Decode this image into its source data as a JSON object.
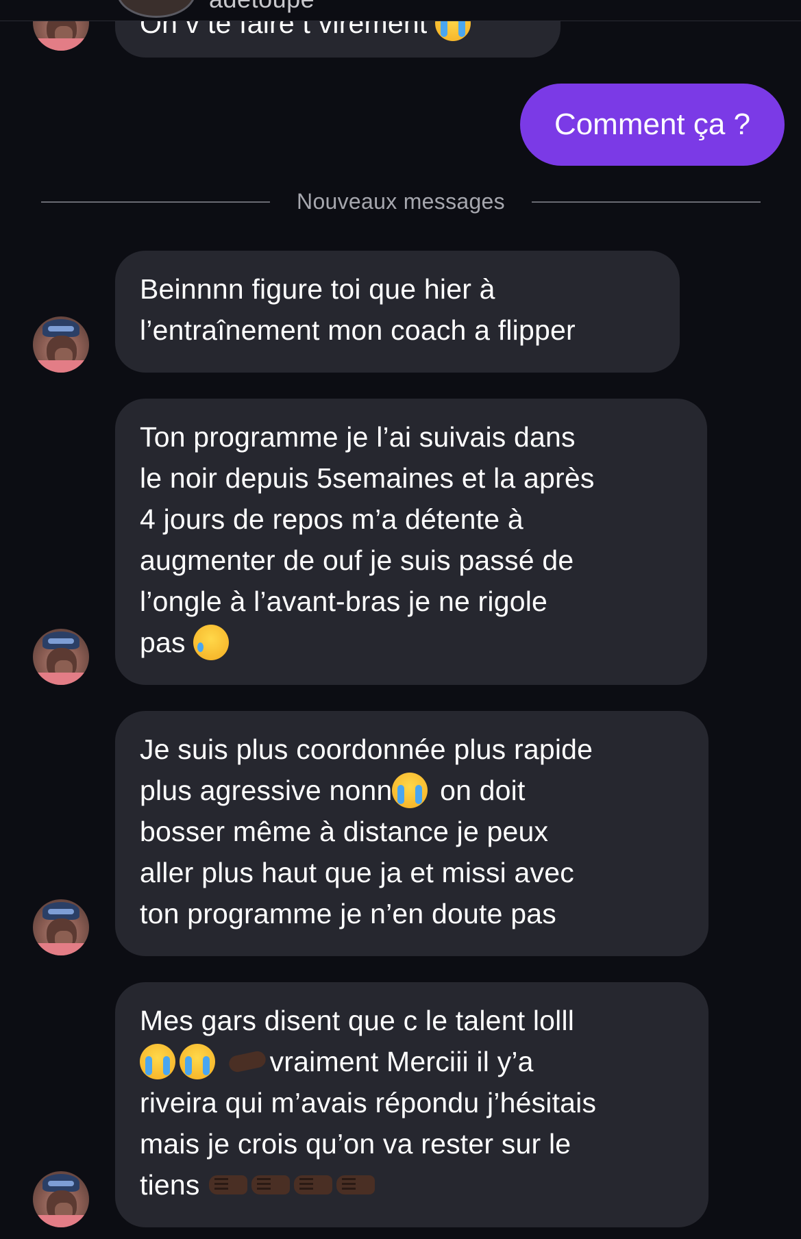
{
  "header": {
    "username": "adetoupe"
  },
  "messages": [
    {
      "direction": "received",
      "lines": [
        "On v te faire t virement"
      ],
      "emoji_after": "loudly-crying-face"
    },
    {
      "direction": "sent",
      "text": "Comment ça ?"
    },
    {
      "direction": "divider",
      "text": "Nouveaux messages"
    },
    {
      "direction": "received",
      "lines": [
        "Beinnnn figure toi que hier à",
        "l’entraînement mon coach a flipper"
      ]
    },
    {
      "direction": "received",
      "lines": [
        "Ton programme je l’ai suivais dans",
        "le noir depuis 5semaines et la après",
        "4 jours de repos  m’a détente à",
        "augmenter de ouf je suis passé de",
        "l’ongle à l’avant-bras je ne rigole",
        "pas"
      ],
      "emoji_after": "sad-but-relieved-face"
    },
    {
      "direction": "received",
      "lines": [
        "Je suis plus coordonnée plus rapide",
        "plus agressive nonn",
        " on doit",
        "bosser même à distance je peux",
        "aller plus haut que ja et missi avec",
        "ton programme je n’en doute pas"
      ]
    },
    {
      "direction": "received",
      "lines": [
        "Mes gars disent que c le talent lolll",
        "vraiment Merciii il y’a",
        "riveira qui m’avais répondu j’hésitais",
        "mais je crois qu’on va rester sur le",
        "tiens"
      ]
    }
  ],
  "colors": {
    "background": "#0c0d13",
    "received_bubble": "#26272f",
    "sent_bubble": "#7b3ae6",
    "divider_text": "#a6a7ae"
  }
}
